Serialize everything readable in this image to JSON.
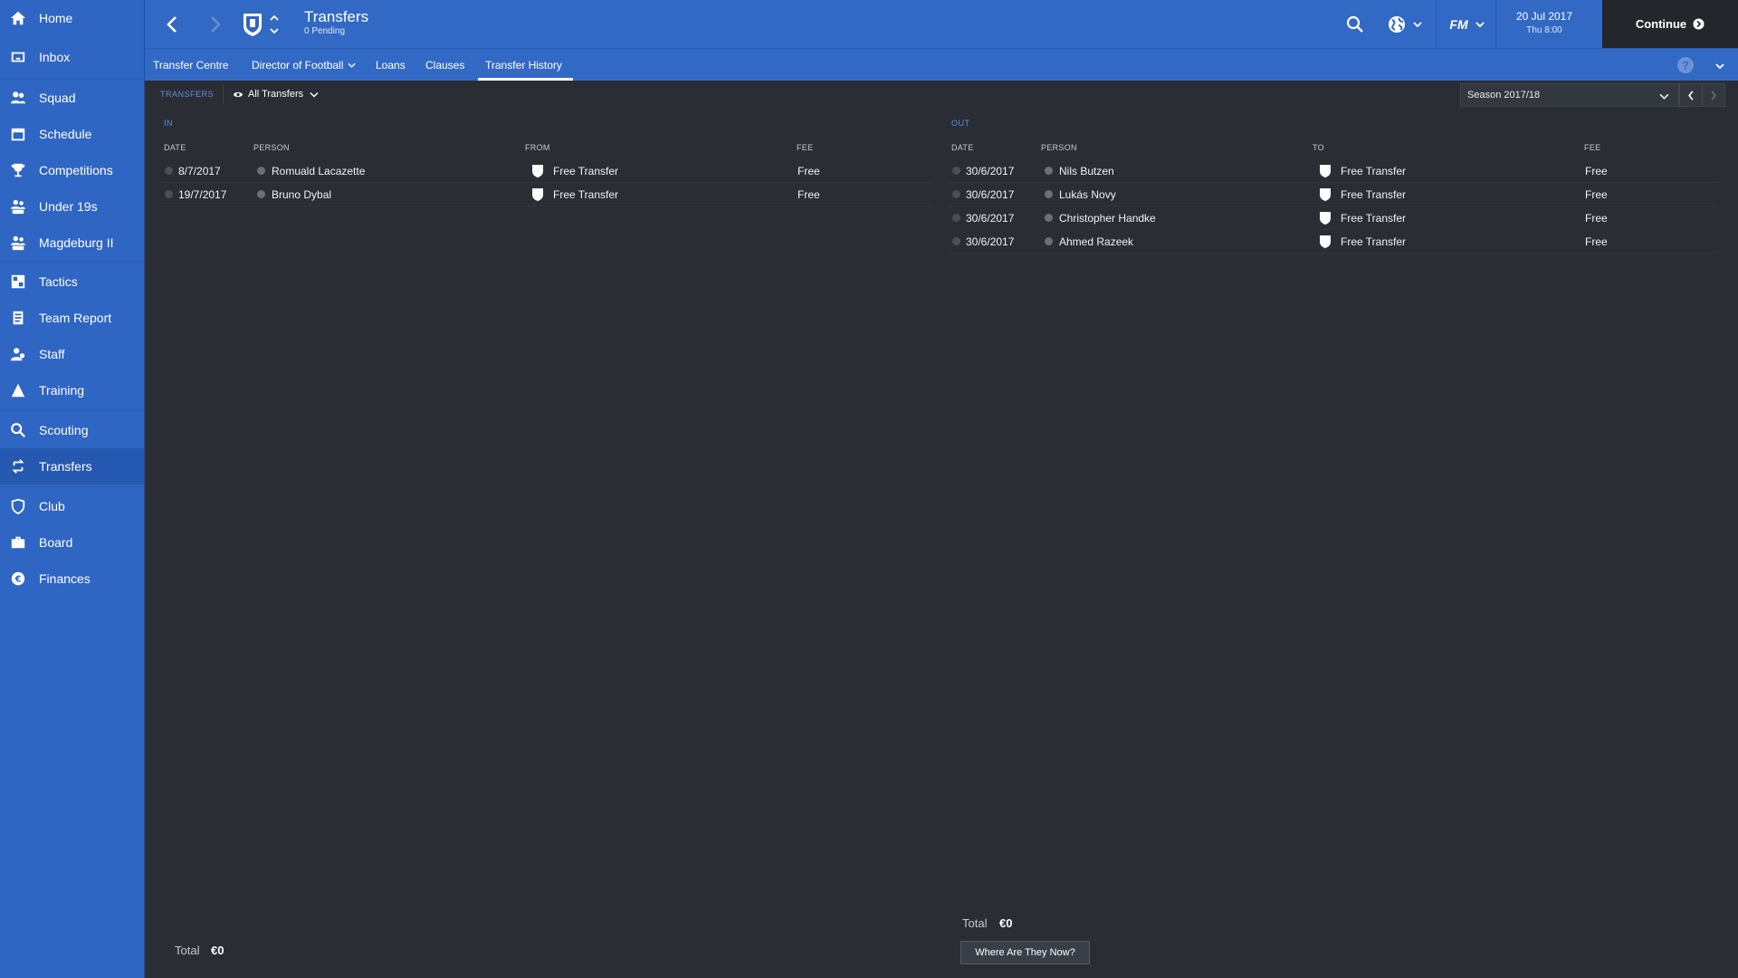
{
  "sidebar": {
    "items": [
      {
        "label": "Home",
        "icon": "home-icon"
      },
      {
        "label": "Inbox",
        "icon": "inbox-icon"
      },
      {
        "label": "Squad",
        "icon": "squad-icon"
      },
      {
        "label": "Schedule",
        "icon": "calendar-icon"
      },
      {
        "label": "Competitions",
        "icon": "trophy-icon"
      },
      {
        "label": "Under 19s",
        "icon": "under-19s-icon"
      },
      {
        "label": "Magdeburg II",
        "icon": "reserve-team-icon"
      },
      {
        "label": "Tactics",
        "icon": "tactics-icon"
      },
      {
        "label": "Team Report",
        "icon": "report-icon"
      },
      {
        "label": "Staff",
        "icon": "staff-icon"
      },
      {
        "label": "Training",
        "icon": "training-icon"
      },
      {
        "label": "Scouting",
        "icon": "search-icon"
      },
      {
        "label": "Transfers",
        "icon": "transfers-icon"
      },
      {
        "label": "Club",
        "icon": "club-shield-icon"
      },
      {
        "label": "Board",
        "icon": "briefcase-icon"
      },
      {
        "label": "Finances",
        "icon": "euro-icon"
      }
    ],
    "active": "Transfers"
  },
  "header": {
    "title": "Transfers",
    "subtitle": "0 Pending",
    "fm_label": "FM",
    "date": "20 Jul 2017",
    "time": "Thu 8:00",
    "continue_label": "Continue"
  },
  "tabs": [
    {
      "label": "Transfer Centre"
    },
    {
      "label": "Director of Football"
    },
    {
      "label": "Loans"
    },
    {
      "label": "Clauses"
    },
    {
      "label": "Transfer History"
    }
  ],
  "active_tab": "Transfer History",
  "filter": {
    "section_label": "TRANSFERS",
    "view": "All Transfers",
    "season": "Season 2017/18"
  },
  "transfers_in": {
    "label": "IN",
    "columns": [
      "DATE",
      "PERSON",
      "FROM",
      "FEE"
    ],
    "rows": [
      {
        "date": "8/7/2017",
        "person": "Romuald Lacazette",
        "club": "Free Transfer",
        "fee": "Free"
      },
      {
        "date": "19/7/2017",
        "person": "Bruno Dybal",
        "club": "Free Transfer",
        "fee": "Free"
      }
    ],
    "total_label": "Total",
    "total_value": "€0"
  },
  "transfers_out": {
    "label": "OUT",
    "columns": [
      "DATE",
      "PERSON",
      "TO",
      "FEE"
    ],
    "rows": [
      {
        "date": "30/6/2017",
        "person": "Nils Butzen",
        "club": "Free Transfer",
        "fee": "Free"
      },
      {
        "date": "30/6/2017",
        "person": "Lukás Novy",
        "club": "Free Transfer",
        "fee": "Free"
      },
      {
        "date": "30/6/2017",
        "person": "Christopher Handke",
        "club": "Free Transfer",
        "fee": "Free"
      },
      {
        "date": "30/6/2017",
        "person": "Ahmed Razeek",
        "club": "Free Transfer",
        "fee": "Free"
      }
    ],
    "total_label": "Total",
    "total_value": "€0",
    "where_button": "Where Are They Now?"
  },
  "colors": {
    "sidebar": "#2f65c3",
    "header": "#3269c5",
    "background": "#2a2e34",
    "accent_label": "#5b8fe0",
    "continue_bg": "#23262b"
  }
}
